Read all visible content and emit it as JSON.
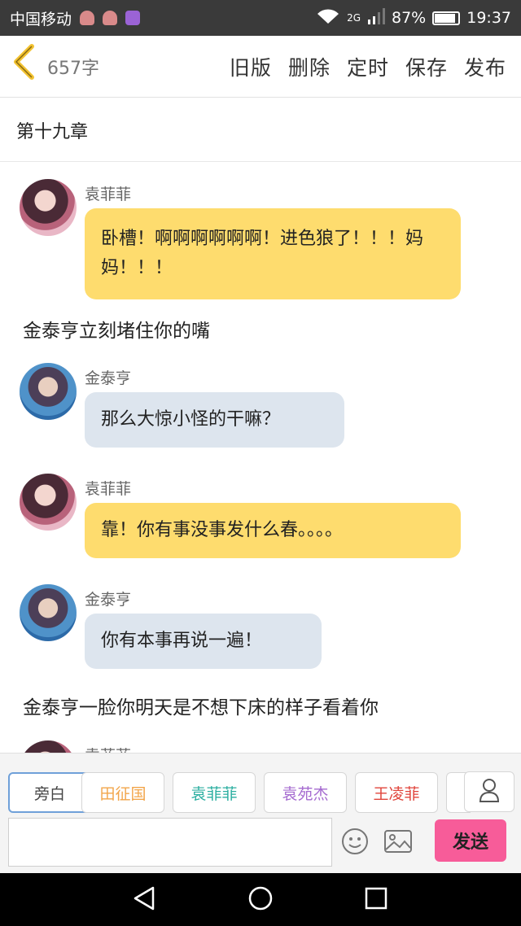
{
  "status_bar": {
    "carrier": "中国移动",
    "network": "2G",
    "battery": "87%",
    "battery_level": 0.87,
    "time": "19:37"
  },
  "header": {
    "word_count": "657字",
    "actions": [
      "旧版",
      "删除",
      "定时",
      "保存",
      "发布"
    ]
  },
  "chapter_title": "第十九章",
  "messages": [
    {
      "type": "chat",
      "speaker": "袁菲菲",
      "text": "卧槽！啊啊啊啊啊啊！进色狼了！！！妈妈！！！",
      "side": "female",
      "color": "yellow"
    },
    {
      "type": "narration",
      "text": "金泰亨立刻堵住你的嘴"
    },
    {
      "type": "chat",
      "speaker": "金泰亨",
      "text": "那么大惊小怪的干嘛？",
      "side": "male",
      "color": "gray"
    },
    {
      "type": "chat",
      "speaker": "袁菲菲",
      "text": "靠！你有事没事发什么春。。。。",
      "side": "female",
      "color": "yellow"
    },
    {
      "type": "chat",
      "speaker": "金泰亨",
      "text": "你有本事再说一遍！",
      "side": "male",
      "color": "gray"
    },
    {
      "type": "narration",
      "text": "金泰亨一脸你明天是不想下床的样子看着你"
    },
    {
      "type": "chat",
      "speaker": "袁菲菲",
      "text": "",
      "side": "female",
      "color": "yellow"
    }
  ],
  "characters": [
    {
      "label": "旁白",
      "color": "#444444"
    },
    {
      "label": "田征国",
      "color": "#f2a54a"
    },
    {
      "label": "袁菲菲",
      "color": "#2aaea0"
    },
    {
      "label": "袁苑杰",
      "color": "#a56bd0"
    },
    {
      "label": "王凌菲",
      "color": "#e0443b"
    }
  ],
  "input": {
    "placeholder": "",
    "send_label": "发送"
  },
  "colors": {
    "accent_yellow": "#f2c230",
    "bubble_yellow": "#fedc6e",
    "bubble_gray": "#dde5ee",
    "send_pink": "#f75c99"
  }
}
